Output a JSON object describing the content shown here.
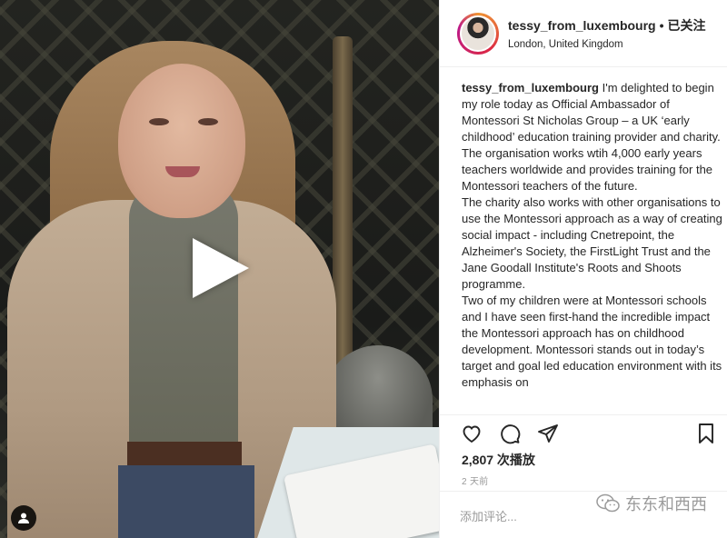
{
  "post": {
    "username": "tessy_from_luxembourg",
    "follow_label": "已关注",
    "location": "London, United Kingdom",
    "caption_paragraphs": [
      "I'm delighted to begin my role today as Official Ambassador of Montessori St Nicholas Group – a UK ‘early childhood’ education training provider and charity. The organisation works wtih 4,000 early years teachers worldwide and provides training for the Montessori teachers of the future.",
      "The charity also works with other organisations to use the Montessori approach as a way of creating social impact - including Cnetrepoint, the Alzheimer's Society, the FirstLight Trust and the Jane Goodall Institute's Roots and Shoots programme.",
      "Two of my children were at Montessori schools and I have seen first-hand the incredible impact the Montessori approach has on childhood development. Montessori stands out in today’s target and goal led education environment with its emphasis on"
    ],
    "views": "2,807 次播放",
    "time_ago": "2 天前"
  },
  "comment": {
    "placeholder": "添加评论..."
  },
  "watermark": {
    "text": "东东和西西"
  },
  "icons": {
    "play": "play-icon",
    "user_tag": "user-tag-icon",
    "like": "heart-icon",
    "comment": "comment-icon",
    "share": "share-icon",
    "save": "bookmark-icon",
    "watermark": "wechat-icon"
  },
  "colors": {
    "text": "#262626",
    "muted": "#999999",
    "divider": "#efefef",
    "watermark": "#9b9b9b"
  }
}
